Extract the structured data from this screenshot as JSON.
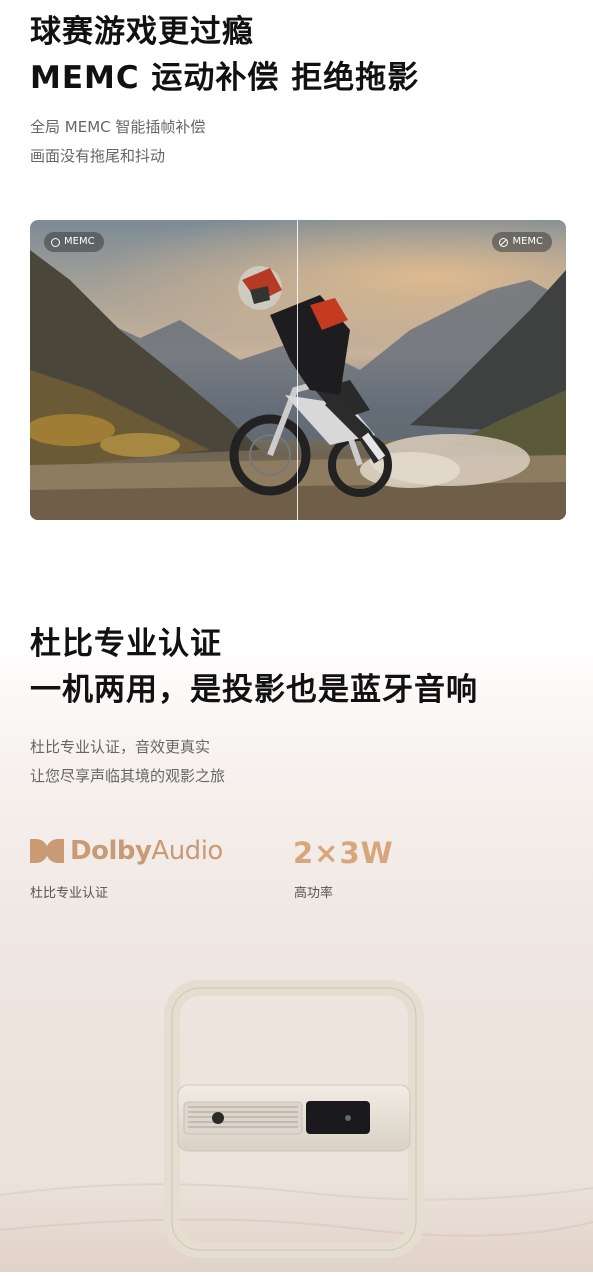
{
  "section1": {
    "title_line1": "球赛游戏更过瘾",
    "title_line2": "MEMC 运动补偿 拒绝拖影",
    "desc_line1": "全局 MEMC 智能插帧补偿",
    "desc_line2": "画面没有拖尾和抖动",
    "badge_on": "MEMC",
    "badge_off": "MEMC"
  },
  "section2": {
    "title_line1": "杜比专业认证",
    "title_line2": "一机两用，是投影也是蓝牙音响",
    "desc_line1": "杜比专业认证，音效更真实",
    "desc_line2": "让您尽享声临其境的观影之旅",
    "dolby_word": "Dolby",
    "audio_word": "Audio",
    "dolby_caption": "杜比专业认证",
    "power_value": "2×3W",
    "power_caption": "高功率"
  },
  "colors": {
    "accent": "#d9a57b",
    "dolby": "#c99a73",
    "subtext": "#666666"
  }
}
